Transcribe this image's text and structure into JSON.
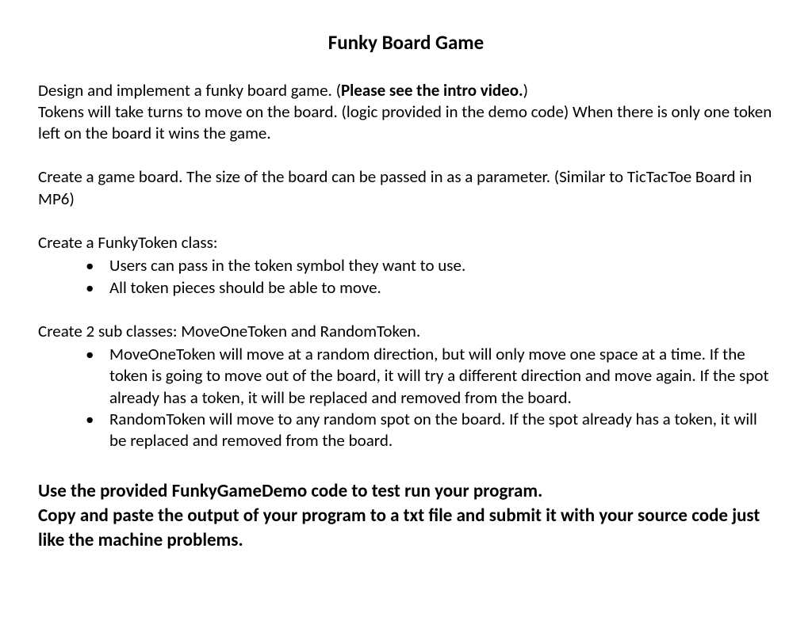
{
  "title": "Funky Board Game",
  "intro": {
    "sentence1_part1": "Design and implement a funky board game. (",
    "sentence1_bold": "Please see the intro video.",
    "sentence1_part2": ")",
    "sentence2": "Tokens will take turns to move on the board. (logic provided in the demo code) When there is only one token left on the board it wins the game."
  },
  "boardPara": "Create a game board. The size of the board can be passed in as a parameter. (Similar to TicTacToe Board in MP6)",
  "funkyToken": {
    "heading": "Create a FunkyToken class:",
    "bullets": [
      "Users can pass in the token symbol they want to use.",
      "All token pieces should be able to move."
    ]
  },
  "subclasses": {
    "heading": "Create 2 sub classes: MoveOneToken and RandomToken.",
    "bullets": [
      "MoveOneToken will move at a random direction, but will only move one space at a time. If the token is going to move out of the board, it will try a different direction and move again. If the spot already has a token, it will be replaced and removed from the board.",
      "RandomToken will move to any random spot on the board.  If the spot already has a token, it will be replaced and removed from the board."
    ]
  },
  "instructions": {
    "line1": "Use the provided FunkyGameDemo code to test run your program.",
    "line2": "Copy and paste the output of your program to a txt file and submit it with your source code just like the machine problems."
  }
}
